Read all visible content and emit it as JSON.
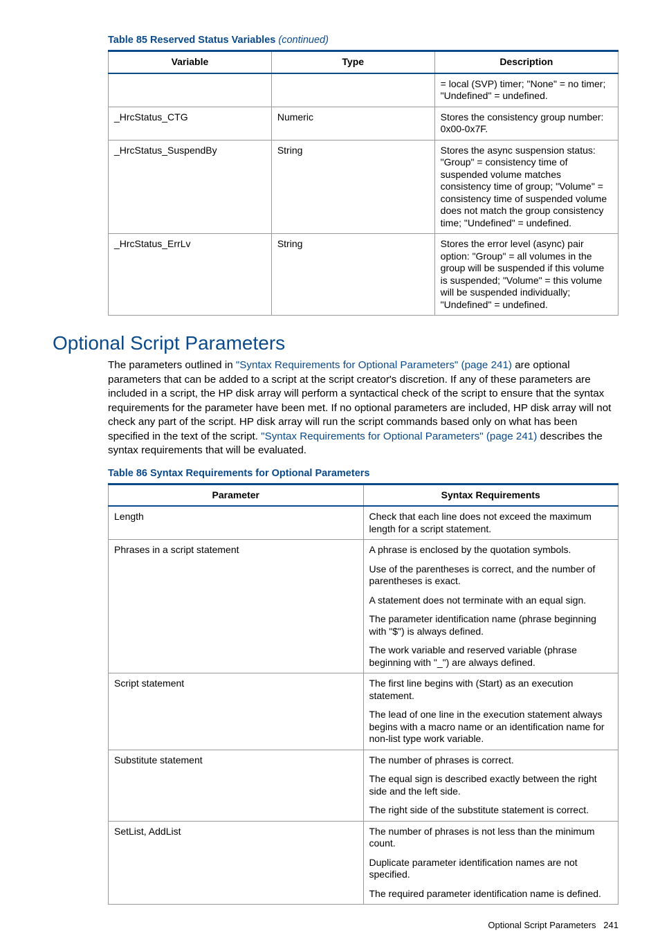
{
  "table85": {
    "caption_prefix": "Table 85 Reserved Status Variables ",
    "caption_suffix": "(continued)",
    "headers": [
      "Variable",
      "Type",
      "Description"
    ],
    "rows": [
      {
        "variable": "",
        "type": "",
        "desc": [
          "= local (SVP) timer; \"None\" = no timer; \"Undefined\" = undefined."
        ]
      },
      {
        "variable": "_HrcStatus_CTG",
        "type": "Numeric",
        "desc": [
          "Stores the consistency group number: 0x00-0x7F."
        ]
      },
      {
        "variable": "_HrcStatus_SuspendBy",
        "type": "String",
        "desc": [
          "Stores the async suspension status: \"Group\" = consistency time of suspended volume matches consistency time of group; \"Volume\" = consistency time of suspended volume does not match the group consistency time; \"Undefined\" = undefined."
        ]
      },
      {
        "variable": "_HrcStatus_ErrLv",
        "type": "String",
        "desc": [
          "Stores the error level (async) pair option: \"Group\" = all volumes in the group will be suspended if this volume is suspended; \"Volume\" = this volume will be suspended individually; \"Undefined\" = undefined."
        ]
      }
    ]
  },
  "section_title": "Optional Script Parameters",
  "para_parts": {
    "p1": "The parameters outlined in ",
    "link1": "\"Syntax Requirements for Optional Parameters\" (page 241)",
    "p2": " are optional parameters that can be added to a script at the script creator's discretion. If any of these parameters are included in a script, the HP disk array will perform a syntactical check of the script to ensure that the syntax requirements for the parameter have been met. If no optional parameters are included, HP disk array will not check any part of the script. HP disk array will run the script commands based only on what has been specified in the text of the script. ",
    "link2": "\"Syntax Requirements for Optional Parameters\" (page 241)",
    "p3": " describes the syntax requirements that will be evaluated."
  },
  "table86": {
    "caption": "Table 86 Syntax Requirements for Optional Parameters",
    "headers": [
      "Parameter",
      "Syntax Requirements"
    ],
    "rows": [
      {
        "param": "Length",
        "reqs": [
          "Check that each line does not exceed the maximum length for a script statement."
        ]
      },
      {
        "param": "Phrases in a script statement",
        "reqs": [
          "A phrase is enclosed by the quotation symbols.",
          "Use of the parentheses is correct, and the number of parentheses is exact.",
          "A statement does not terminate with an equal sign.",
          "The parameter identification name (phrase beginning with \"$\") is always defined.",
          "The work variable and reserved variable (phrase beginning with \"_\") are always defined."
        ]
      },
      {
        "param": "Script statement",
        "reqs": [
          "The first line begins with (Start) as an execution statement.",
          "The lead of one line in the execution statement always begins with a macro name or an identification name for non-list type work variable."
        ]
      },
      {
        "param": "Substitute statement",
        "reqs": [
          "The number of phrases is correct.",
          "The equal sign is described exactly between the right side and the left side.",
          "The right side of the substitute statement is correct."
        ]
      },
      {
        "param": "SetList, AddList",
        "reqs": [
          "The number of phrases is not less than the minimum count.",
          "Duplicate parameter identification names are not specified.",
          "The required parameter identification name is defined."
        ]
      }
    ]
  },
  "footer": {
    "label": "Optional Script Parameters",
    "page": "241"
  }
}
